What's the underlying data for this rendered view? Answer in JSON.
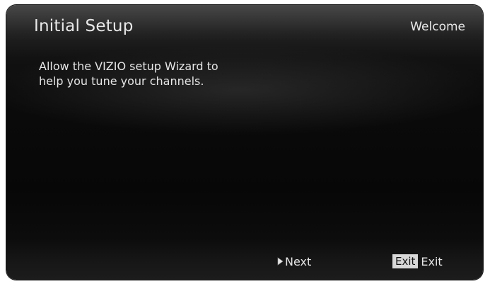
{
  "header": {
    "title": "Initial Setup",
    "page_label": "Welcome"
  },
  "body": {
    "lines": [
      "Allow the VIZIO setup Wizard to",
      "help you tune your channels."
    ]
  },
  "footer": {
    "next_label": "Next",
    "exit_key": "Exit",
    "exit_label": "Exit"
  },
  "icons": {
    "next": "play-arrow-icon"
  },
  "colors": {
    "text": "#e8e8e8",
    "key_badge_bg": "#d8d8d8",
    "screen_bg": "#070707"
  }
}
